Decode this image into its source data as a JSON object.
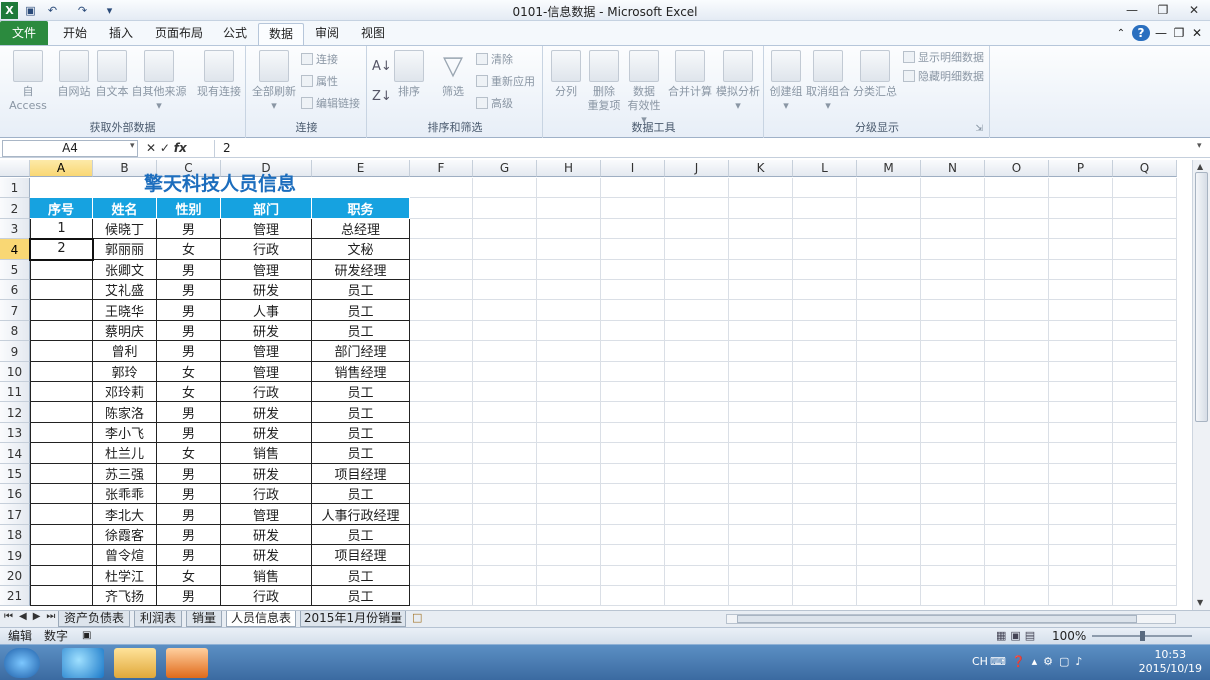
{
  "window": {
    "title": "0101-信息数据 - Microsoft Excel"
  },
  "quick_access": {
    "save_icon": "save-icon",
    "undo_icon": "undo-icon",
    "redo_icon": "redo-icon",
    "customize_icon": "customize-icon"
  },
  "ribbon_tabs": [
    "文件",
    "开始",
    "插入",
    "页面布局",
    "公式",
    "数据",
    "审阅",
    "视图"
  ],
  "active_tab": "数据",
  "ribbon": {
    "get_external": {
      "label": "获取外部数据",
      "buttons": [
        "自 Access",
        "自网站",
        "自文本",
        "自其他来源",
        "现有连接"
      ]
    },
    "connections": {
      "label": "连接",
      "refresh": "全部刷新",
      "small": [
        "连接",
        "属性",
        "编辑链接"
      ]
    },
    "sort_filter": {
      "label": "排序和筛选",
      "sort": "排序",
      "filter": "筛选",
      "small": [
        "清除",
        "重新应用",
        "高级"
      ]
    },
    "data_tools": {
      "label": "数据工具",
      "split": "分列",
      "remove_dup_1": "删除",
      "remove_dup_2": "重复项",
      "validation_1": "数据",
      "validation_2": "有效性",
      "consolidate": "合并计算",
      "whatif": "模拟分析"
    },
    "outline": {
      "label": "分级显示",
      "group": "创建组",
      "ungroup": "取消组合",
      "subtotal": "分类汇总",
      "show_detail": "显示明细数据",
      "hide_detail": "隐藏明细数据"
    }
  },
  "formula_bar": {
    "name_box": "A4",
    "formula": "2",
    "fx_label": "fx"
  },
  "columns": [
    "A",
    "B",
    "C",
    "D",
    "E",
    "F",
    "G",
    "H",
    "I",
    "J",
    "K",
    "L",
    "M",
    "N",
    "O",
    "P",
    "Q"
  ],
  "selected_column": "A",
  "selected_row": "4",
  "rows": [
    "1",
    "2",
    "3",
    "4",
    "5",
    "6",
    "7",
    "8",
    "9",
    "10",
    "11",
    "12",
    "13",
    "14",
    "15",
    "16",
    "17",
    "18",
    "19",
    "20",
    "21"
  ],
  "sheet": {
    "title": "擎天科技人员信息",
    "headers": [
      "序号",
      "姓名",
      "性别",
      "部门",
      "职务"
    ],
    "data": [
      [
        "1",
        "候晓丁",
        "男",
        "管理",
        "总经理"
      ],
      [
        "2",
        "郭丽丽",
        "女",
        "行政",
        "文秘"
      ],
      [
        "",
        "张卿文",
        "男",
        "管理",
        "研发经理"
      ],
      [
        "",
        "艾礼盛",
        "男",
        "研发",
        "员工"
      ],
      [
        "",
        "王晓华",
        "男",
        "人事",
        "员工"
      ],
      [
        "",
        "蔡明庆",
        "男",
        "研发",
        "员工"
      ],
      [
        "",
        "曾利",
        "男",
        "管理",
        "部门经理"
      ],
      [
        "",
        "郭玲",
        "女",
        "管理",
        "销售经理"
      ],
      [
        "",
        "邓玲莉",
        "女",
        "行政",
        "员工"
      ],
      [
        "",
        "陈家洛",
        "男",
        "研发",
        "员工"
      ],
      [
        "",
        "李小飞",
        "男",
        "研发",
        "员工"
      ],
      [
        "",
        "杜兰儿",
        "女",
        "销售",
        "员工"
      ],
      [
        "",
        "苏三强",
        "男",
        "研发",
        "项目经理"
      ],
      [
        "",
        "张乖乖",
        "男",
        "行政",
        "员工"
      ],
      [
        "",
        "李北大",
        "男",
        "管理",
        "人事行政经理"
      ],
      [
        "",
        "徐霞客",
        "男",
        "研发",
        "员工"
      ],
      [
        "",
        "曾令煊",
        "男",
        "研发",
        "项目经理"
      ],
      [
        "",
        "杜学江",
        "女",
        "销售",
        "员工"
      ],
      [
        "",
        "齐飞扬",
        "男",
        "行政",
        "员工"
      ]
    ]
  },
  "sheet_tabs": [
    "资产负债表",
    "利润表",
    "销量",
    "人员信息表",
    "2015年1月份销量"
  ],
  "active_sheet": "人员信息表",
  "status": {
    "mode": "编辑",
    "num": "数字",
    "zoom": "100%"
  },
  "taskbar": {
    "time": "10:53",
    "date": "2015/10/19",
    "lang": "CH"
  }
}
